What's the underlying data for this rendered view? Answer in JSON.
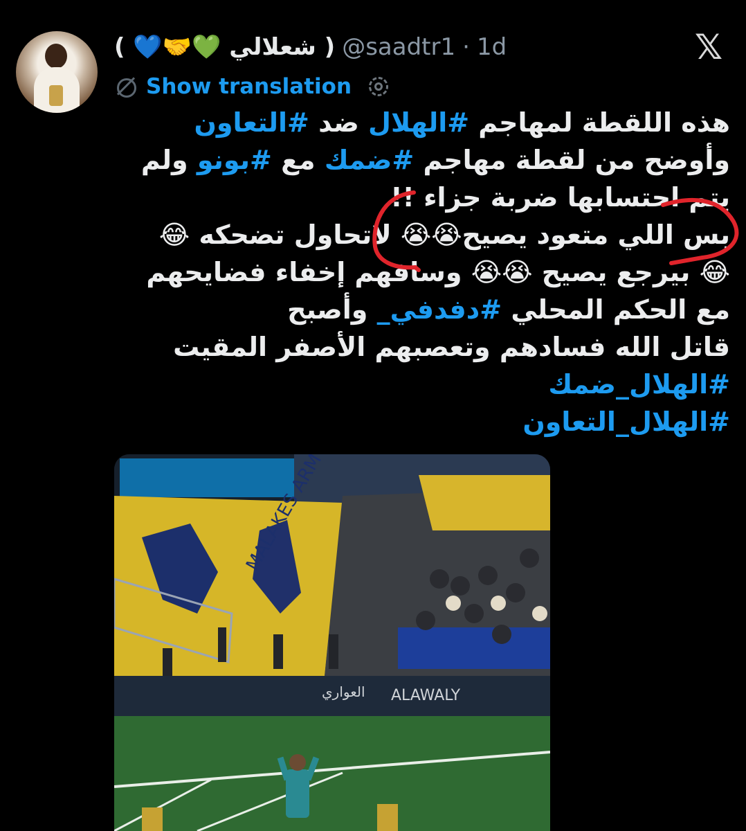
{
  "tweet": {
    "display_name": "( شعلالي 💚🤝💙 )",
    "handle": "@saadtr1",
    "separator": "·",
    "time": "1d",
    "translate_label": "Show translation",
    "icons": {
      "platform": "x-logo",
      "translate": "globe-icon",
      "settings": "gear-icon"
    },
    "lines": [
      {
        "plain_a": "هذه اللقطة لمهاجم ",
        "hash_a": "#الهلال",
        "plain_b": " ضد ",
        "hash_b": "#التعاون",
        "plain_c": ""
      },
      {
        "plain_a": "وأوضح من لقطة مهاجم ",
        "hash_a": "#ضمك",
        "plain_b": " مع ",
        "hash_b": "#بونو",
        "plain_c": " ولم"
      },
      {
        "text": "يتم احتسابها ضربة جزاء !!"
      },
      {
        "text": "بس اللي متعود يصيح😭😭 لاتحاول تضحكه 😂"
      },
      {
        "text": "😂 بيرجع يصيح 😭😭 وسافهم إخفاء فضايحهم"
      },
      {
        "plain_a": "مع الحكم المحلي ",
        "hash_a": "#دفدفي_",
        "plain_b": "  وأصبح"
      },
      {
        "text": "قاتل الله فسادهم وتعصبهم الأصفر المقيت"
      },
      {
        "hash_a": "#الهلال_ضمك"
      },
      {
        "hash_a": "#الهلال_التعاون"
      }
    ],
    "media": {
      "stadium_sign": "MALAKES ARMY",
      "ad_board_text": "ALAWALY",
      "ad_board_text_ar": "العواري"
    }
  },
  "colors": {
    "accent": "#1d9bf0",
    "annotation": "#e0242b",
    "background": "#000000"
  }
}
